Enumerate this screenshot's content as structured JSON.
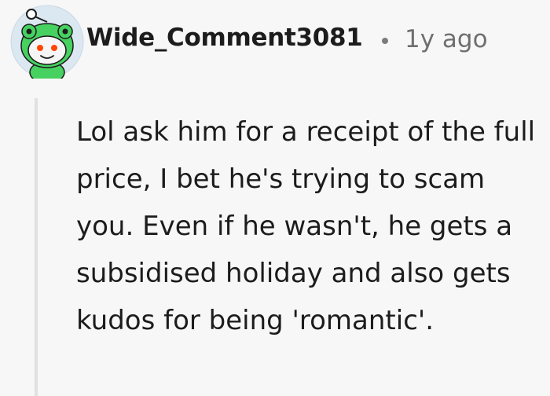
{
  "comment": {
    "username": "Wide_Comment3081",
    "separator": "•",
    "timestamp": "1y ago",
    "body": "Lol ask him for a receipt of the full price, I bet he's trying to scam you. Even if he wasn't, he gets a subsidised holiday and also gets kudos for being 'romantic'.",
    "avatar_icon": "snoo-frog-hood-avatar-icon"
  },
  "colors": {
    "background": "#f7f7f7",
    "username": "#1c1c1c",
    "timestamp": "#6f6f6f",
    "thread_line": "#e1e1e1",
    "avatar_green": "#46d160",
    "avatar_bg": "#d9e6f0"
  }
}
